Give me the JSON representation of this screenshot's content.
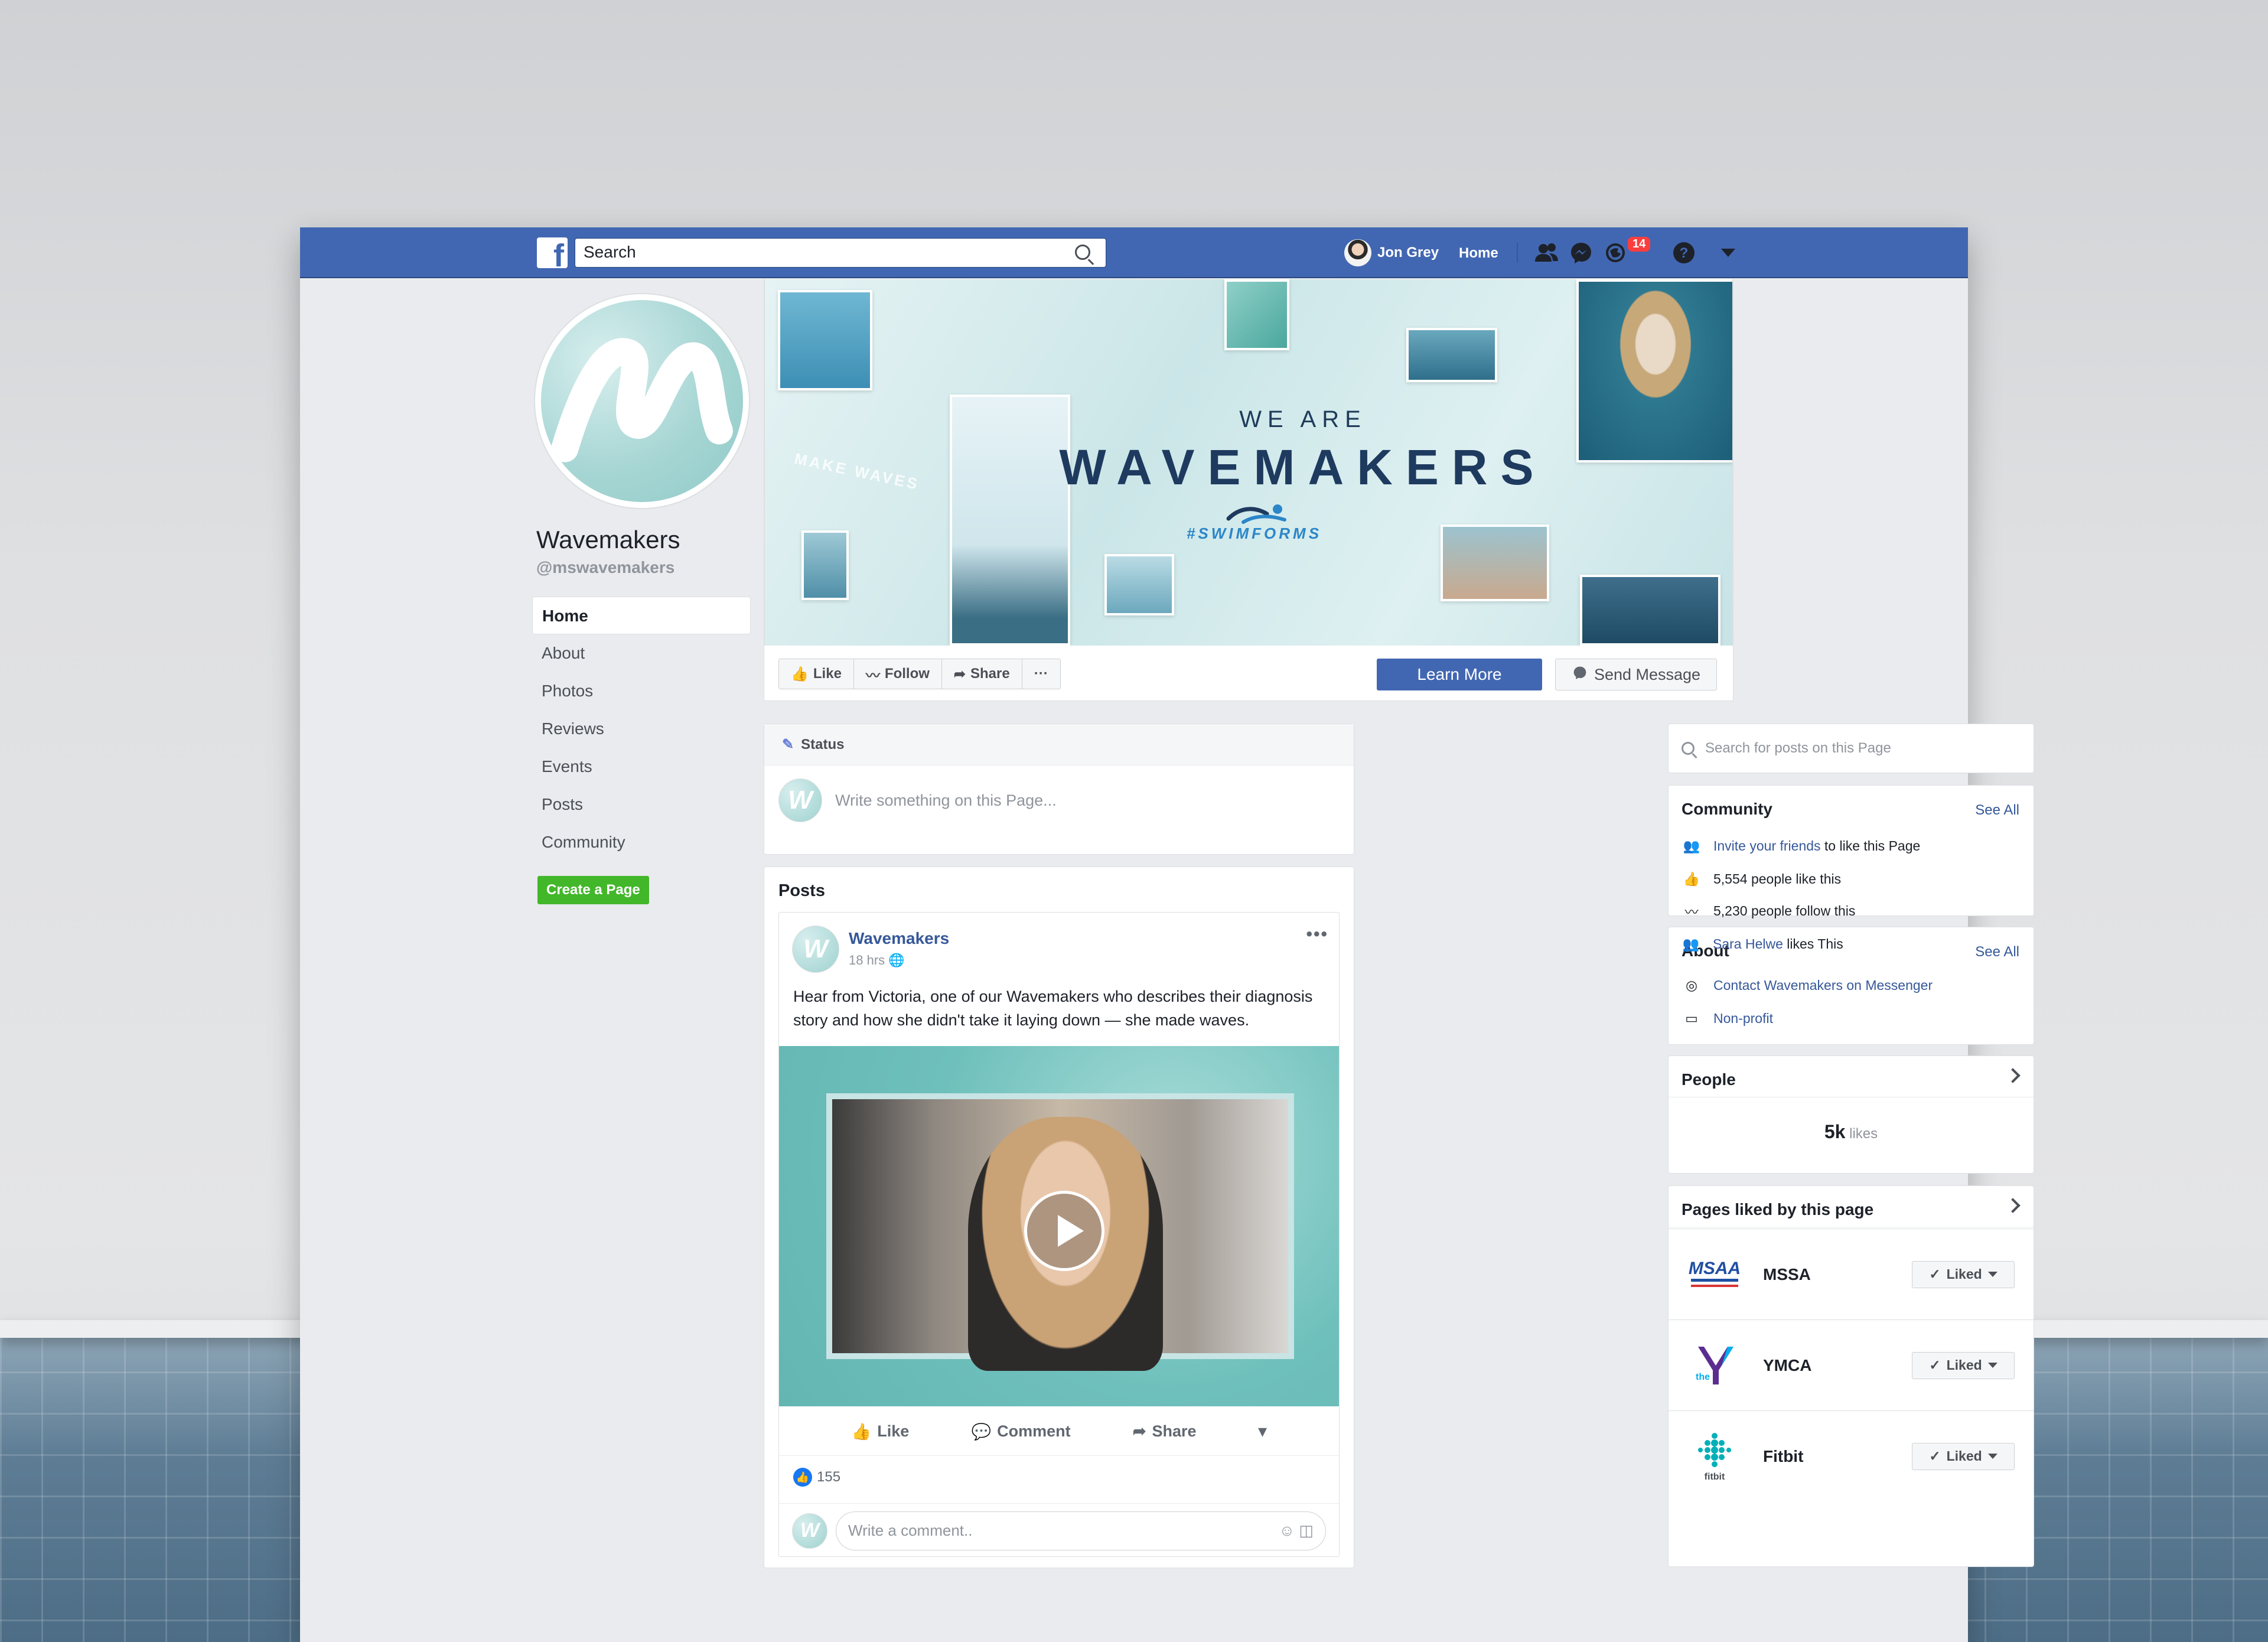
{
  "topbar": {
    "search_placeholder": "Search",
    "user_name": "Jon Grey",
    "home_label": "Home",
    "notification_count": "14",
    "icons": [
      "friend-requests-icon",
      "messenger-icon",
      "notifications-icon",
      "help-icon",
      "account-menu-icon"
    ]
  },
  "page": {
    "name": "Wavemakers",
    "handle": "@mswavemakers"
  },
  "left_nav": {
    "items": [
      "Home",
      "About",
      "Photos",
      "Reviews",
      "Events",
      "Posts",
      "Community"
    ],
    "active": "Home",
    "create_page": "Create a Page"
  },
  "cover": {
    "subtitle": "WE ARE",
    "title": "WAVEMAKERS",
    "hashtag": "#SWIMFORMS",
    "make_waves": "MAKE WAVES"
  },
  "actions": {
    "like": "Like",
    "follow": "Follow",
    "share": "Share",
    "more": "···",
    "learn_more": "Learn More",
    "send_message": "Send Message"
  },
  "status": {
    "tab": "Status",
    "placeholder": "Write something on this Page..."
  },
  "posts": {
    "section_title": "Posts",
    "post": {
      "author": "Wavemakers",
      "time": "18 hrs",
      "text": "Hear from Victoria, one of our Wavemakers who describes their diagnosis story and how she didn't take it laying down — she made waves.",
      "like": "Like",
      "comment": "Comment",
      "share": "Share",
      "reactions": "155",
      "comment_placeholder": "Write a comment.."
    }
  },
  "sidebar": {
    "search_placeholder": "Search for posts on this Page",
    "community": {
      "title": "Community",
      "see_all": "See All",
      "invite_link": "Invite your friends",
      "invite_rest": " to like this Page",
      "likes": "5,554 people like this",
      "follows": "5,230 people follow this",
      "friend_name": "Sara Helwe",
      "friend_rest": " likes This"
    },
    "about": {
      "title": "About",
      "see_all": "See All",
      "messenger": "Contact Wavemakers on Messenger",
      "category": "Non-profit"
    },
    "people": {
      "title": "People",
      "count": "5k",
      "count_label": " likes"
    },
    "pages_liked": {
      "title": "Pages liked by this page",
      "pages": [
        {
          "name": "MSSA",
          "button": "Liked"
        },
        {
          "name": "YMCA",
          "button": "Liked"
        },
        {
          "name": "Fitbit",
          "button": "Liked"
        }
      ]
    }
  },
  "colors": {
    "facebook_blue": "#4267b2",
    "link_blue": "#365899",
    "create_green": "#42b72a",
    "notification_red": "#fa3e3e"
  }
}
